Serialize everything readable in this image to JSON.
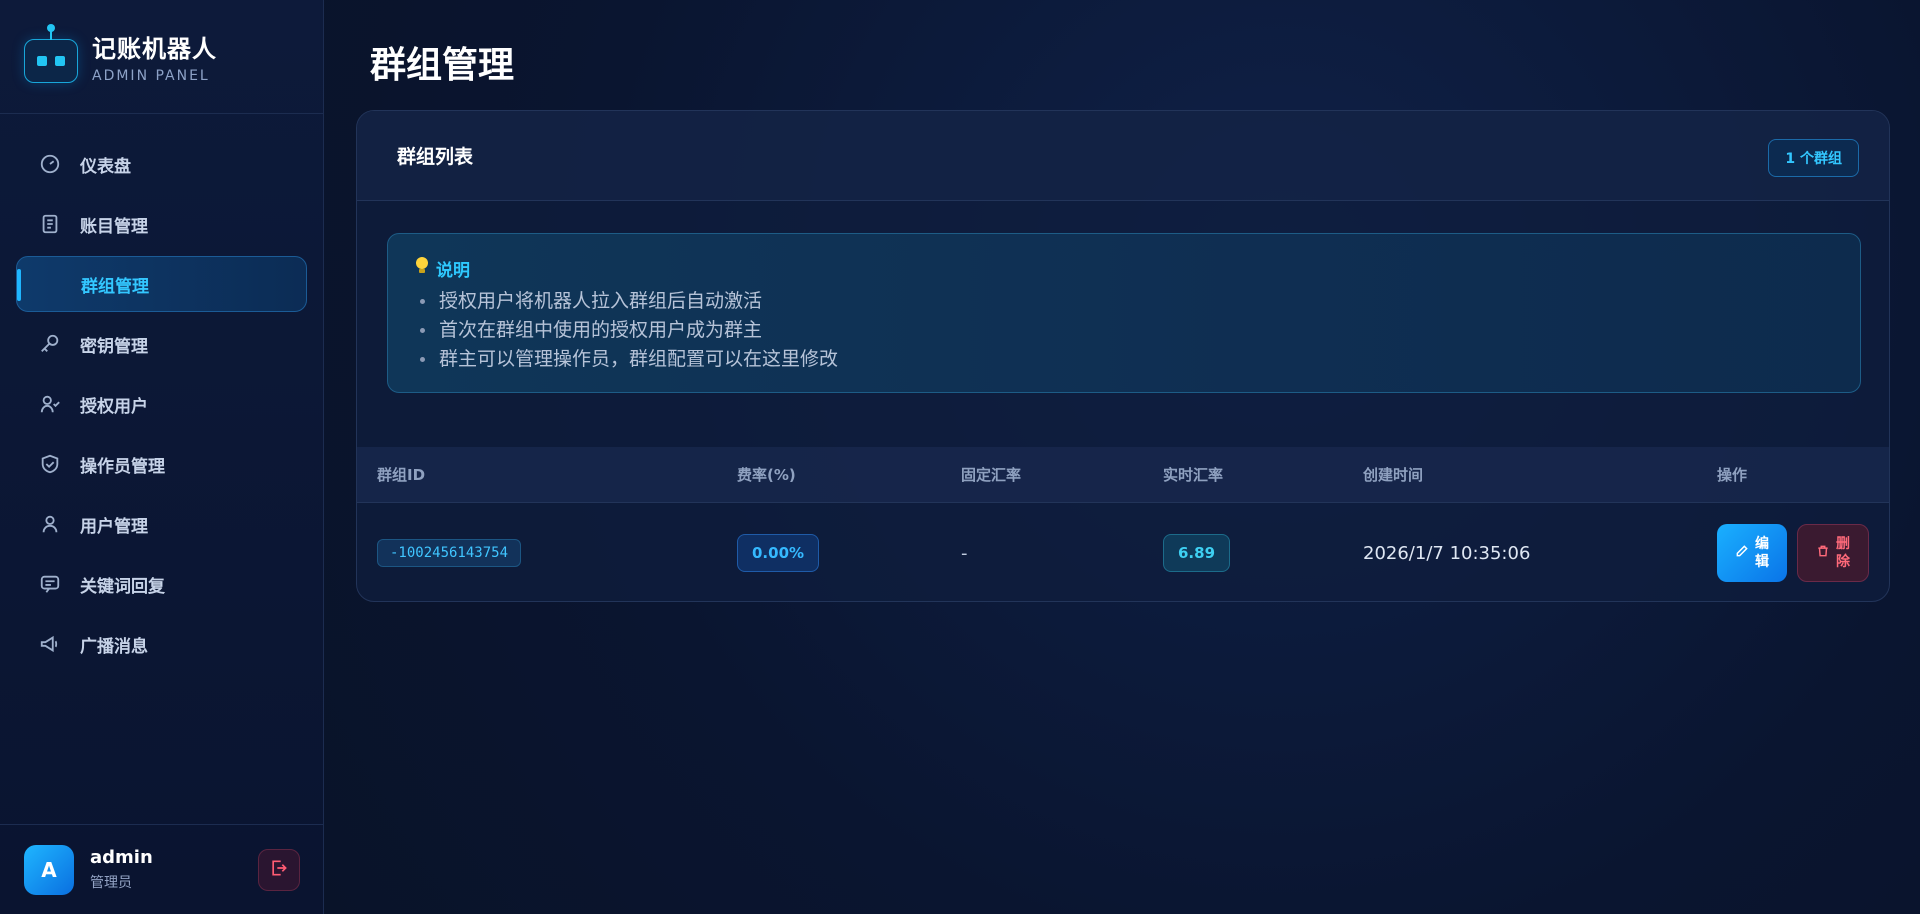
{
  "brand": {
    "title": "记账机器人",
    "subtitle": "ADMIN PANEL"
  },
  "nav": [
    {
      "label": "仪表盘",
      "icon": "gauge-icon",
      "active": false
    },
    {
      "label": "账目管理",
      "icon": "receipt-icon",
      "active": false
    },
    {
      "label": "群组管理",
      "icon": "group-icon",
      "active": true
    },
    {
      "label": "密钥管理",
      "icon": "key-icon",
      "active": false
    },
    {
      "label": "授权用户",
      "icon": "user-check-icon",
      "active": false
    },
    {
      "label": "操作员管理",
      "icon": "shield-check-icon",
      "active": false
    },
    {
      "label": "用户管理",
      "icon": "user-icon",
      "active": false
    },
    {
      "label": "关键词回复",
      "icon": "message-icon",
      "active": false
    },
    {
      "label": "广播消息",
      "icon": "megaphone-icon",
      "active": false
    }
  ],
  "user": {
    "avatar_letter": "A",
    "name": "admin",
    "role": "管理员"
  },
  "page": {
    "title": "群组管理"
  },
  "card": {
    "title": "群组列表",
    "count_badge": "1 个群组",
    "note": {
      "title": "说明",
      "lines": [
        "授权用户将机器人拉入群组后自动激活",
        "首次在群组中使用的授权用户成为群主",
        "群主可以管理操作员，群组配置可以在这里修改"
      ]
    },
    "table": {
      "headers": [
        "群组ID",
        "费率(%)",
        "固定汇率",
        "实时汇率",
        "创建时间",
        "操作"
      ],
      "rows": [
        {
          "group_id": "-1002456143754",
          "fee_rate": "0.00%",
          "fixed_rate": "-",
          "live_rate": "6.89",
          "created_at": "2026/1/7 10:35:06",
          "edit_label": [
            "编",
            "辑"
          ],
          "delete_label": [
            "删",
            "除"
          ]
        }
      ]
    }
  },
  "colors": {
    "accent": "#1fb6ff",
    "danger": "#ff6a7a",
    "bg": "#0a1530"
  }
}
